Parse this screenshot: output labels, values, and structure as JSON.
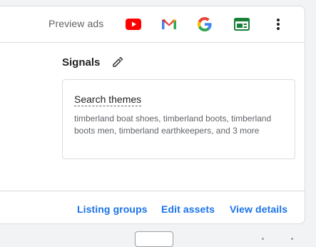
{
  "toolbar": {
    "preview_label": "Preview ads",
    "icons": [
      "youtube-icon",
      "gmail-icon",
      "google-icon",
      "display-icon",
      "more-vert-icon"
    ]
  },
  "signals": {
    "title": "Signals",
    "edit_icon": "pencil-icon",
    "search_themes": {
      "title": "Search themes",
      "text": "timberland boat shoes, timberland boots, timberland boots men, timberland earthkeepers, and 3 more"
    }
  },
  "actions": {
    "listing_groups": "Listing groups",
    "edit_assets": "Edit assets",
    "view_details": "View details"
  },
  "colors": {
    "accent": "#1a73e8",
    "youtube_red": "#ff0000",
    "display_green": "#188038",
    "text_primary": "#202124",
    "text_secondary": "#5f6368",
    "border": "#dadce0"
  }
}
